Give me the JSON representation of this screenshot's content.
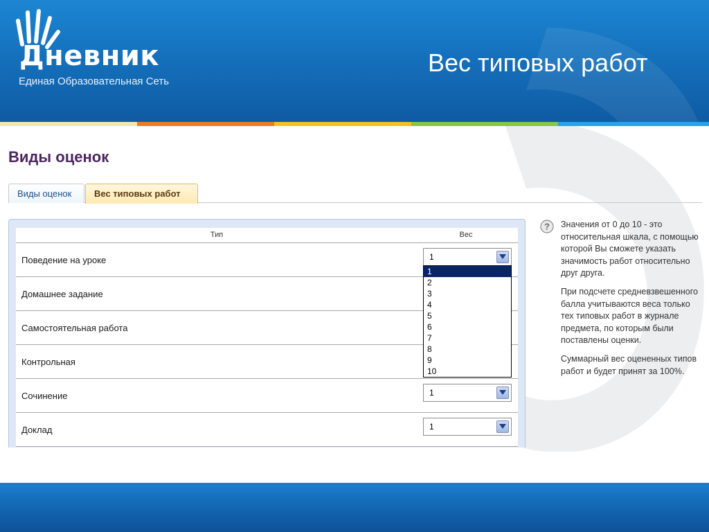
{
  "header": {
    "logo_text": "Дневник",
    "logo_subtitle": "Единая Образовательная Сеть",
    "slide_title": "Вес типовых работ"
  },
  "stripe_colors": [
    "#f5e6a8",
    "#f07b1e",
    "#f5c21a",
    "#8cc63f",
    "#2aa2e6"
  ],
  "section_title": "Виды оценок",
  "tabs": [
    {
      "label": "Виды оценок",
      "active": false
    },
    {
      "label": "Вес типовых работ",
      "active": true
    }
  ],
  "table": {
    "col_type": "Тип",
    "col_weight": "Вес",
    "rows": [
      {
        "label": "Поведение на уроке",
        "weight": "1"
      },
      {
        "label": "Домашнее задание",
        "weight": "1"
      },
      {
        "label": "Самостоятельная работа",
        "weight": "1"
      },
      {
        "label": "Контрольная",
        "weight": "1"
      },
      {
        "label": "Сочинение",
        "weight": "1"
      },
      {
        "label": "Доклад",
        "weight": "1"
      }
    ]
  },
  "dropdown": {
    "options": [
      "1",
      "2",
      "3",
      "4",
      "5",
      "6",
      "7",
      "8",
      "9",
      "10"
    ],
    "selected": "1"
  },
  "help": {
    "paragraphs": [
      "Значения от 0 до 10 - это относительная шкала, с помощью которой Вы сможете указать значимость работ относительно друг друга.",
      "При подсчете средневзвешенного балла учитываются веса только тех типовых работ в журнале предмета, по которым были поставлены оценки.",
      "Суммарный вес оцененных типов работ и будет принят за 100%."
    ]
  },
  "colors": {
    "header_blue": "#1571bd",
    "title_purple": "#4b2560",
    "selected_option": "#0a246a"
  }
}
